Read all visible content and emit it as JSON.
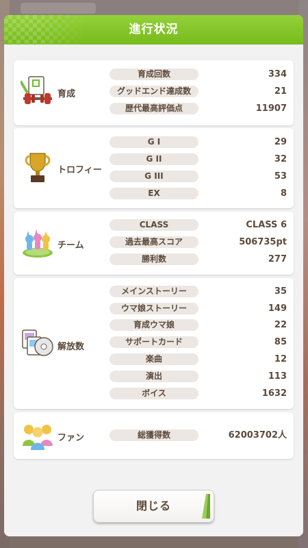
{
  "dialog": {
    "title": "進行状況"
  },
  "sections": {
    "training": {
      "label": "育成",
      "rows": [
        {
          "label": "育成回数",
          "value": "334"
        },
        {
          "label": "グッドエンド達成数",
          "value": "21"
        },
        {
          "label": "歴代最高評価点",
          "value": "11907"
        }
      ]
    },
    "trophy": {
      "label": "トロフィー",
      "rows": [
        {
          "label": "G I",
          "value": "29"
        },
        {
          "label": "G II",
          "value": "32"
        },
        {
          "label": "G III",
          "value": "53"
        },
        {
          "label": "EX",
          "value": "8"
        }
      ]
    },
    "team": {
      "label": "チーム",
      "rows": [
        {
          "label": "CLASS",
          "value": "CLASS 6"
        },
        {
          "label": "過去最高スコア",
          "value": "506735pt"
        },
        {
          "label": "勝利数",
          "value": "277"
        }
      ]
    },
    "unlocks": {
      "label": "解放数",
      "rows": [
        {
          "label": "メインストーリー",
          "value": "35"
        },
        {
          "label": "ウマ娘ストーリー",
          "value": "149"
        },
        {
          "label": "育成ウマ娘",
          "value": "22"
        },
        {
          "label": "サポートカード",
          "value": "85"
        },
        {
          "label": "楽曲",
          "value": "12"
        },
        {
          "label": "演出",
          "value": "113"
        },
        {
          "label": "ボイス",
          "value": "1632"
        }
      ]
    },
    "fans": {
      "label": "ファン",
      "rows": [
        {
          "label": "総獲得数",
          "value": "62003702人"
        }
      ]
    }
  },
  "buttons": {
    "close_label": "閉じる"
  },
  "icons": {
    "training": "dumbbell-notepad-icon",
    "trophy": "trophy-icon",
    "team": "team-figures-icon",
    "unlocks": "cards-disc-icon",
    "fans": "fans-icon"
  },
  "colors": {
    "header_green": "#7fc22a",
    "text_brown": "#5c4a3c",
    "pill_bg": "#ece7e2"
  }
}
